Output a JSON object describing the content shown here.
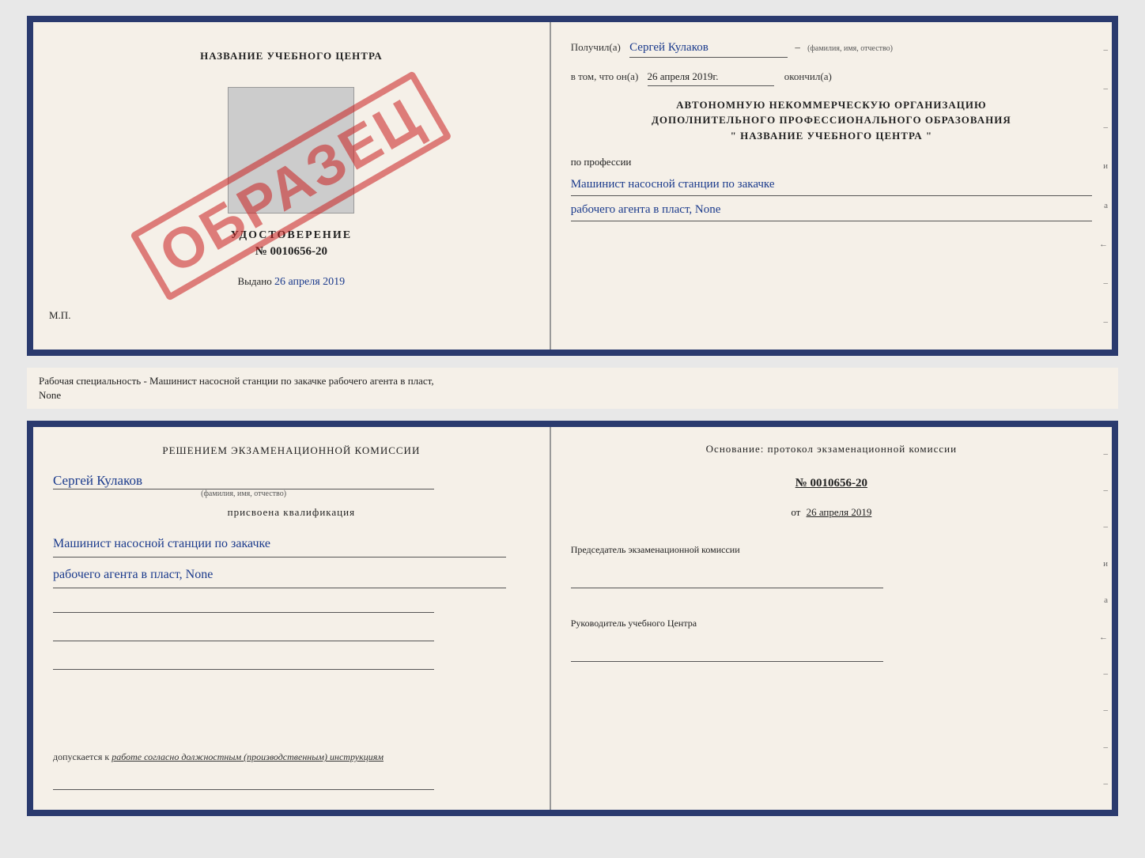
{
  "top_doc": {
    "left": {
      "institution_name": "НАЗВАНИЕ УЧЕБНОГО ЦЕНТРА",
      "udostoverenie_title": "УДОСТОВЕРЕНИЕ",
      "udostoverenie_number": "№ 0010656-20",
      "vydano_label": "Выдано",
      "vydano_date": "26 апреля 2019",
      "mp": "М.П.",
      "obrazets": "ОБРАЗЕЦ"
    },
    "right": {
      "poluchil_label": "Получил(а)",
      "poluchil_name": "Сергей Кулаков",
      "fio_label": "(фамилия, имя, отчество)",
      "vtom_label": "в том, что он(а)",
      "vtom_date": "26 апреля 2019г.",
      "okonchil_label": "окончил(а)",
      "org_line1": "АВТОНОМНУЮ НЕКОММЕРЧЕСКУЮ ОРГАНИЗАЦИЮ",
      "org_line2": "ДОПОЛНИТЕЛЬНОГО ПРОФЕССИОНАЛЬНОГО ОБРАЗОВАНИЯ",
      "org_line3": "\"  НАЗВАНИЕ УЧЕБНОГО ЦЕНТРА  \"",
      "po_professii": "по профессии",
      "profession_line1": "Машинист насосной станции по закачке",
      "profession_line2": "рабочего агента в пласт, None"
    }
  },
  "info_bar": {
    "text1": "Рабочая специальность - Машинист насосной станции по закачке рабочего агента в пласт,",
    "text2": "None"
  },
  "bottom_doc": {
    "left": {
      "komissia_text": "Решением экзаменационной комиссии",
      "name_handwritten": "Сергей Кулаков",
      "fio_label": "(фамилия, имя, отчество)",
      "prisvoena": "присвоена квалификация",
      "qual_line1": "Машинист насосной станции по закачке",
      "qual_line2": "рабочего агента в пласт, None",
      "dopuskaetsya_label": "допускается к",
      "dopuskaetsya_text": "работе согласно должностным (производственным) инструкциям"
    },
    "right": {
      "osnovaniye_text": "Основание: протокол экзаменационной комиссии",
      "protocol_number": "№ 0010656-20",
      "ot_label": "от",
      "protocol_date": "26 апреля 2019",
      "predsedatel_label": "Председатель экзаменационной комиссии",
      "rukovoditel_label": "Руководитель учебного Центра"
    }
  },
  "margin_dashes": [
    "-",
    "-",
    "-",
    "-",
    "и",
    "а",
    "←",
    "-",
    "-",
    "-",
    "-",
    "-",
    "-"
  ]
}
